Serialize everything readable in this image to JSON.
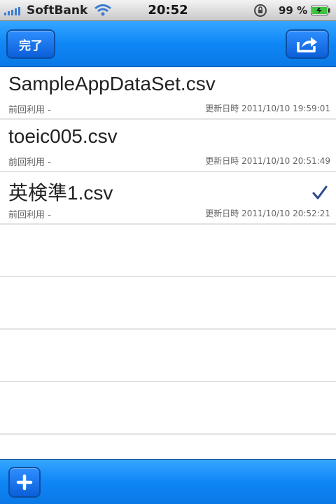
{
  "status_bar": {
    "carrier": "SoftBank",
    "time": "20:52",
    "battery_percent": "99 %",
    "icons": [
      "signal-icon",
      "wifi-icon",
      "rotation-lock-icon",
      "battery-icon"
    ]
  },
  "nav": {
    "done_label": "完了",
    "share_icon": "share-icon"
  },
  "files": [
    {
      "name": "SampleAppDataSet.csv",
      "last_used": "前回利用 -",
      "updated": "更新日時 2011/10/10  19:59:01",
      "checked": false
    },
    {
      "name": "toeic005.csv",
      "last_used": "前回利用 -",
      "updated": "更新日時 2011/10/10  20:51:49",
      "checked": false
    },
    {
      "name": "英検準1.csv",
      "last_used": "前回利用 -",
      "updated": "更新日時 2011/10/10  20:52:21",
      "checked": true
    }
  ],
  "toolbar": {
    "add_icon": "plus-icon"
  },
  "colors": {
    "bar_blue": "#0f86f6",
    "check": "#2b4a8a"
  }
}
